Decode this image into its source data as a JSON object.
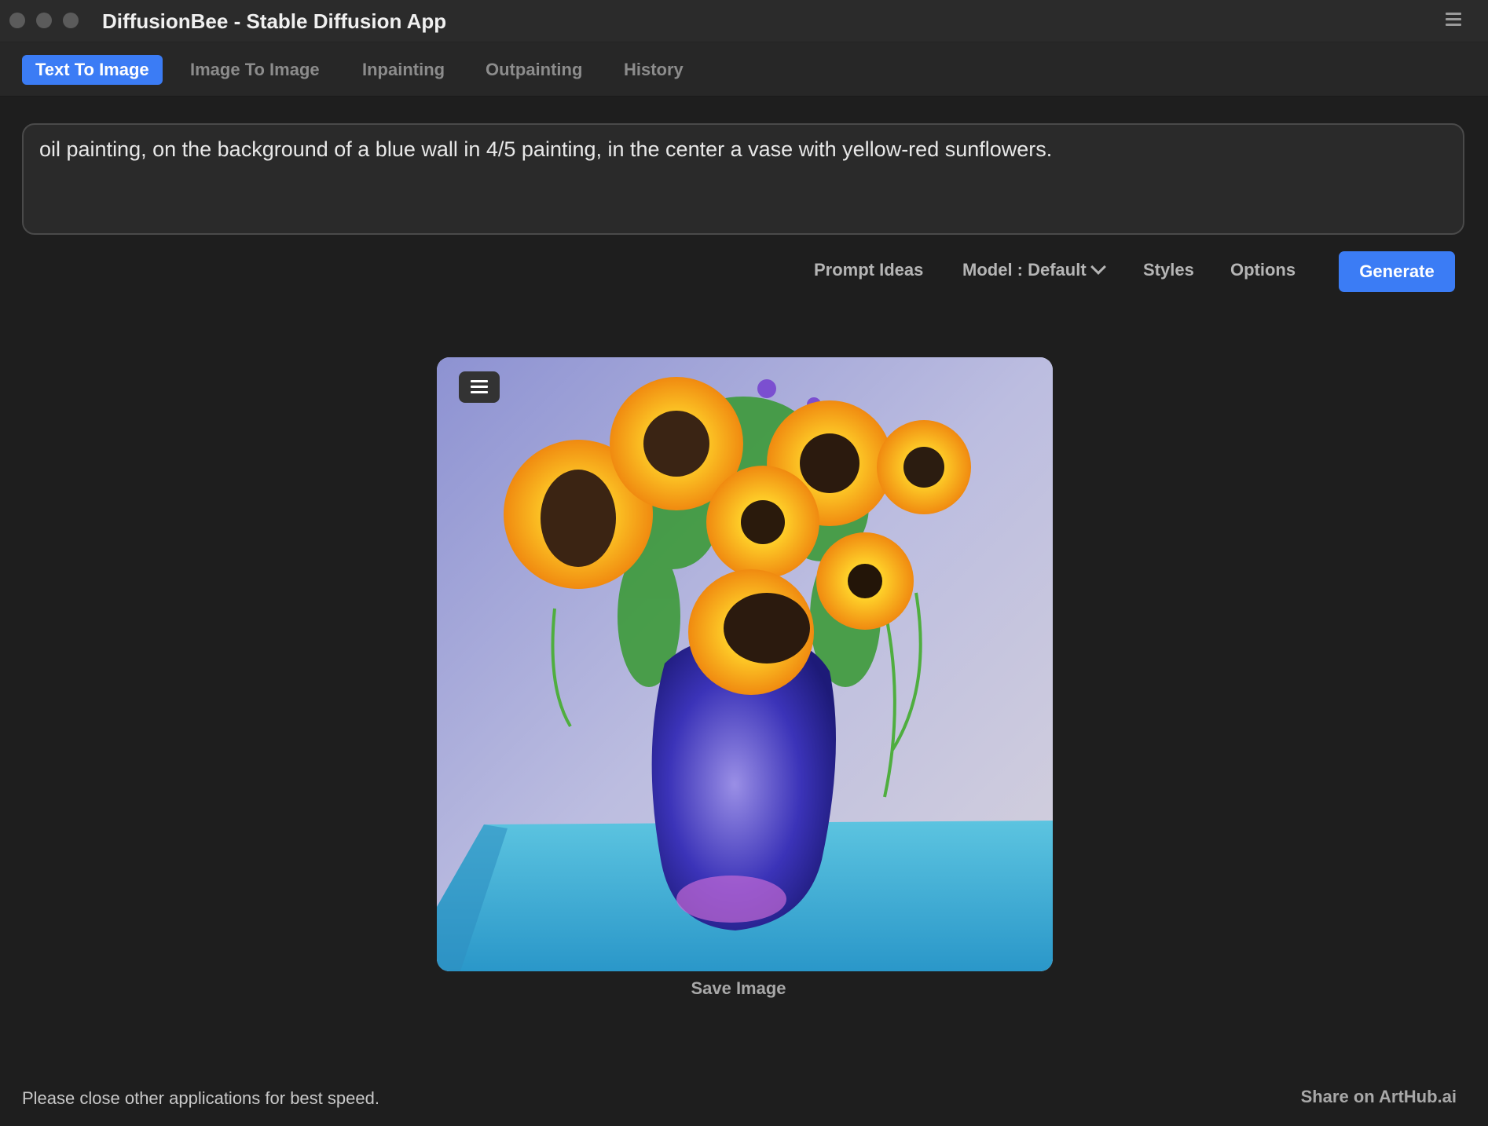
{
  "window": {
    "title": "DiffusionBee - Stable Diffusion App",
    "menu_icon": "hamburger-menu-icon"
  },
  "tabs": [
    {
      "label": "Text To Image",
      "active": true
    },
    {
      "label": "Image To Image",
      "active": false
    },
    {
      "label": "Inpainting",
      "active": false
    },
    {
      "label": "Outpainting",
      "active": false
    },
    {
      "label": "History",
      "active": false
    }
  ],
  "prompt": {
    "value": "oil painting, on the background of a blue wall in 4/5 painting, in the center a vase with yellow-red sunflowers."
  },
  "toolbar": {
    "prompt_ideas": "Prompt Ideas",
    "model": "Model : Default",
    "styles": "Styles",
    "options": "Options",
    "generate": "Generate"
  },
  "result": {
    "image_menu_icon": "hamburger-menu-icon",
    "save_label": "Save Image"
  },
  "footer": {
    "hint": "Please close other applications for best speed.",
    "share": "Share on ArtHub.ai"
  },
  "colors": {
    "accent": "#3b7cf5",
    "background": "#1e1e1e",
    "titlebar": "#2b2b2b"
  }
}
